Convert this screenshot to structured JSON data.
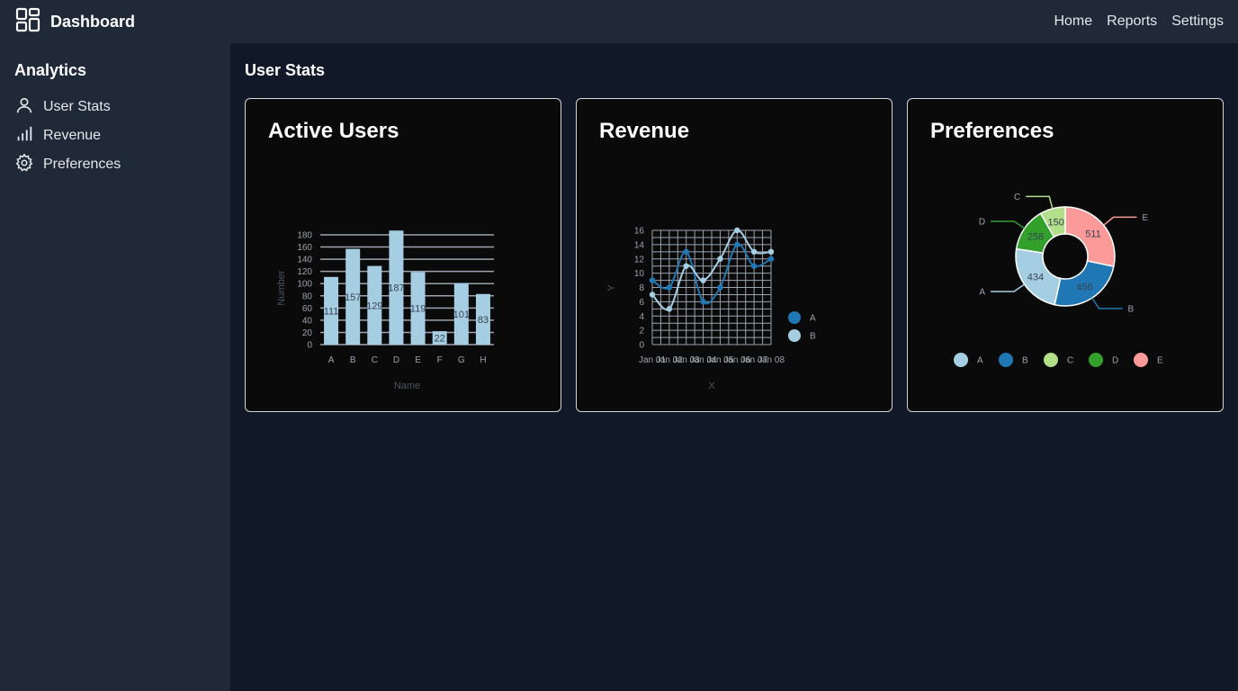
{
  "app": {
    "title": "Dashboard"
  },
  "nav": {
    "home": "Home",
    "reports": "Reports",
    "settings": "Settings"
  },
  "sidebar": {
    "heading": "Analytics",
    "items": [
      {
        "label": "User Stats",
        "icon": "user-icon"
      },
      {
        "label": "Revenue",
        "icon": "bar-chart-icon"
      },
      {
        "label": "Preferences",
        "icon": "gear-icon"
      }
    ]
  },
  "main": {
    "title": "User Stats"
  },
  "cards": {
    "active_users": {
      "title": "Active Users"
    },
    "revenue": {
      "title": "Revenue"
    },
    "preferences": {
      "title": "Preferences"
    }
  },
  "chart_data": [
    {
      "type": "bar",
      "title": "Active Users",
      "categories": [
        "A",
        "B",
        "C",
        "D",
        "E",
        "F",
        "G",
        "H"
      ],
      "values": [
        111,
        157,
        129,
        187,
        119,
        22,
        101,
        83
      ],
      "xlabel": "Name",
      "ylabel": "Number",
      "ylim": [
        0,
        180
      ],
      "yticks": [
        0,
        20,
        40,
        60,
        80,
        100,
        120,
        140,
        160,
        180
      ],
      "grid": true,
      "color": "#a6cee3"
    },
    {
      "type": "line",
      "title": "Revenue",
      "x": [
        "Jan 01",
        "Jan 02",
        "Jan 03",
        "Jan 04",
        "Jan 05",
        "Jan 06",
        "Jan 07",
        "Jan 08"
      ],
      "xtick_labels": [
        "Jan 01",
        "Jan 02",
        "Jan 03",
        "Jan 04",
        "Jan 05",
        "Jan 06",
        "Jan 07",
        "Jan 08"
      ],
      "series": [
        {
          "name": "A",
          "color": "#1f78b4",
          "values": [
            9,
            8,
            13,
            6,
            8,
            14,
            11,
            12
          ]
        },
        {
          "name": "B",
          "color": "#a6cee3",
          "values": [
            7,
            5,
            11,
            9,
            12,
            16,
            13,
            13
          ]
        }
      ],
      "xlabel": "X",
      "ylabel": "Y",
      "ylim": [
        0,
        16
      ],
      "yticks": [
        0,
        2,
        4,
        6,
        8,
        10,
        12,
        14,
        16
      ],
      "grid": true,
      "legend": "right"
    },
    {
      "type": "pie",
      "title": "Preferences",
      "donut": true,
      "slices": [
        {
          "label": "A",
          "value": 434,
          "color": "#a6cee3"
        },
        {
          "label": "B",
          "value": 456,
          "color": "#1f78b4"
        },
        {
          "label": "C",
          "value": 150,
          "color": "#b2df8a"
        },
        {
          "label": "D",
          "value": 258,
          "color": "#33a02c"
        },
        {
          "label": "E",
          "value": 511,
          "color": "#fb9a99"
        }
      ],
      "legend": "bottom"
    }
  ]
}
